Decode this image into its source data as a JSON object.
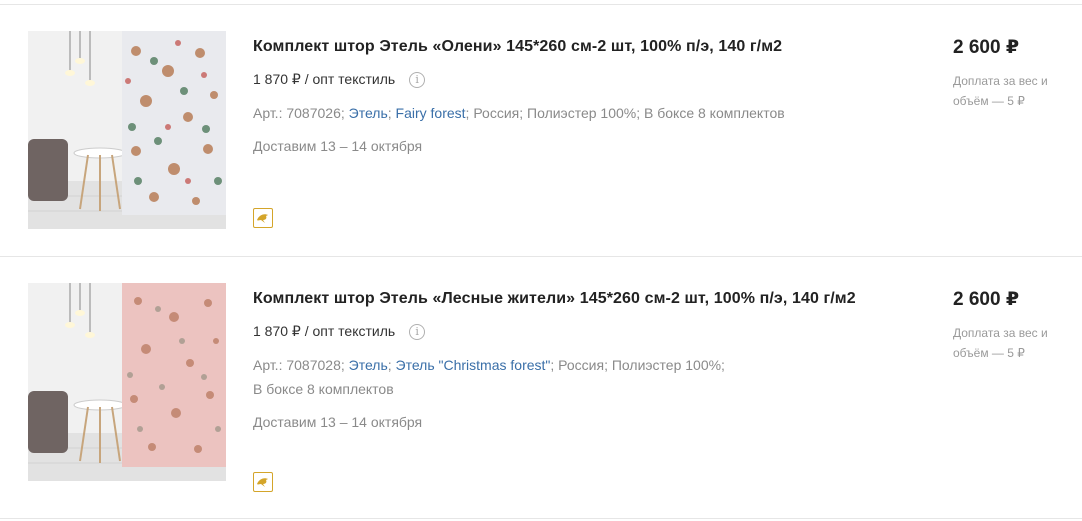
{
  "products": [
    {
      "title": "Комплект штор Этель «Олени» 145*260 см-2 шт, 100% п/э, 140 г/м2",
      "wholesale_price": "1 870 ₽ / опт текстиль",
      "meta_article": "Арт.: 7087026;",
      "meta_brand": "Этель",
      "meta_collection": "Fairy forest",
      "meta_country": "Россия;",
      "meta_material": "Полиэстер 100%;",
      "meta_box": "В боксе 8 комплектов",
      "delivery": "Доставим 13 – 14 октября",
      "price": "2 600 ₽",
      "surcharge": "Доплата за вес и объём — 5 ₽",
      "curtain_color": "#e9eaee",
      "badge_icon": "dolphin-icon"
    },
    {
      "title": "Комплект штор Этель «Лесные жители» 145*260 см-2 шт, 100% п/э, 140 г/м2",
      "wholesale_price": "1 870 ₽ / опт текстиль",
      "meta_article": "Арт.: 7087028;",
      "meta_brand": "Этель",
      "meta_collection": "Этель \"Christmas forest\"",
      "meta_country": "Россия;",
      "meta_material": "Полиэстер 100%;",
      "meta_box": "В боксе 8 комплектов",
      "delivery": "Доставим 13 – 14 октября",
      "price": "2 600 ₽",
      "surcharge": "Доплата за вес и объём — 5 ₽",
      "curtain_color": "#ecc3c0",
      "badge_icon": "dolphin-icon"
    }
  ],
  "colors": {
    "link": "#3a6fa8",
    "badge_border": "#d4a52a",
    "muted_text": "#8a8a8a"
  }
}
